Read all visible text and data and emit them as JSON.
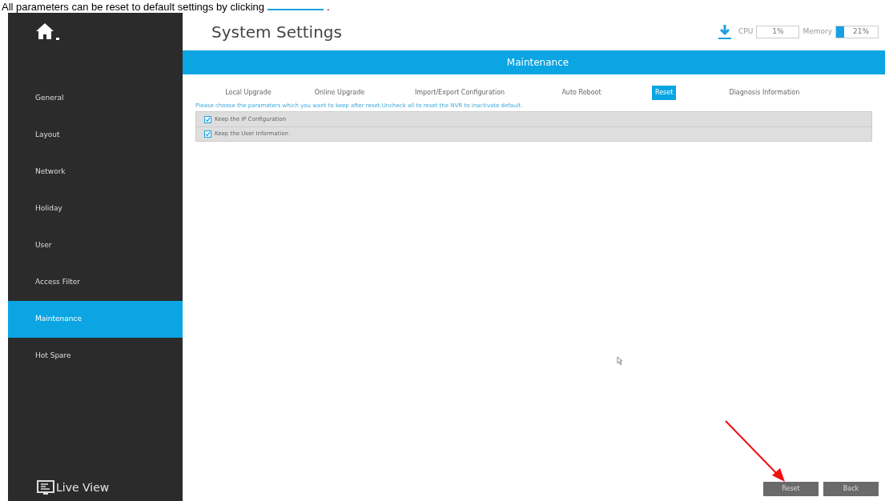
{
  "document_caption": {
    "text": "All parameters can be reset to default settings by clicking",
    "end": "."
  },
  "sidebar": {
    "items": [
      {
        "label": "General",
        "selected": false
      },
      {
        "label": "Layout",
        "selected": false
      },
      {
        "label": "Network",
        "selected": false
      },
      {
        "label": "Holiday",
        "selected": false
      },
      {
        "label": "User",
        "selected": false
      },
      {
        "label": "Access Filter",
        "selected": false
      },
      {
        "label": "Maintenance",
        "selected": true
      },
      {
        "label": "Hot Spare",
        "selected": false
      }
    ],
    "footer": "Live View"
  },
  "header": {
    "title": "System Settings",
    "cpu_label": "CPU",
    "cpu_value": "1%",
    "memory_label": "Memory",
    "memory_value": "21%"
  },
  "section_title": "Maintenance",
  "tabs": [
    {
      "label": "Local Upgrade",
      "selected": false
    },
    {
      "label": "Online Upgrade",
      "selected": false
    },
    {
      "label": "Import/Export Configuration",
      "selected": false
    },
    {
      "label": "Auto Reboot",
      "selected": false
    },
    {
      "label": "Reset",
      "selected": true
    },
    {
      "label": "Diagnosis Information",
      "selected": false
    }
  ],
  "instruction": "Please choose the parameters which you want to keep after reset.Uncheck all to reset the NVR to inactivate default.",
  "options": [
    {
      "label": "Keep the IP Configuration",
      "checked": true
    },
    {
      "label": "Keep the User Information",
      "checked": true
    }
  ],
  "buttons": [
    "Reset",
    "Back"
  ]
}
